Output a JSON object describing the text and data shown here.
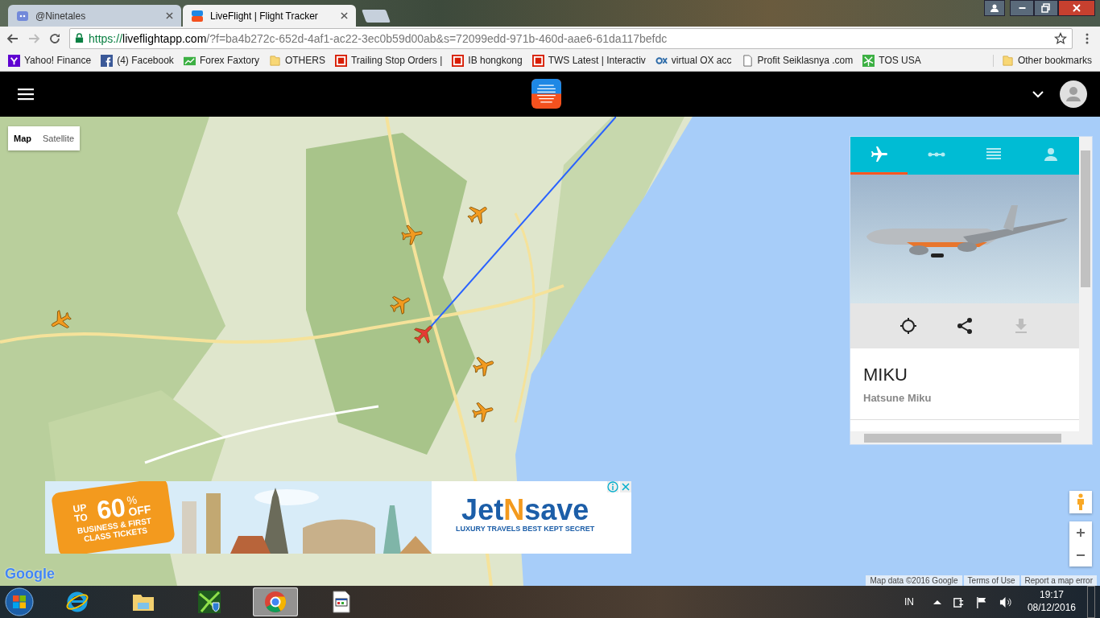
{
  "browser": {
    "tabs": [
      {
        "title": "@Ninetales",
        "selected": false,
        "kind": "discord"
      },
      {
        "title": "LiveFlight | Flight Tracker",
        "selected": true,
        "kind": "liveflight"
      }
    ],
    "url": {
      "scheme": "https://",
      "host": "liveflightapp.com",
      "path": "/?f=ba4b272c-652d-4af1-ac22-3ec0b59d00ab&s=72099edd-971b-460d-aae6-61da117befdc"
    },
    "bookmarks": [
      {
        "label": "Yahoo! Finance",
        "kind": "yahoo"
      },
      {
        "label": "(4) Facebook",
        "kind": "facebook"
      },
      {
        "label": "Forex Faxtory",
        "kind": "chart"
      },
      {
        "label": "OTHERS",
        "kind": "folder"
      },
      {
        "label": "Trailing Stop Orders |",
        "kind": "ib"
      },
      {
        "label": "IB hongkong",
        "kind": "ib"
      },
      {
        "label": "TWS Latest | Interactiv",
        "kind": "ib"
      },
      {
        "label": "virtual OX acc",
        "kind": "ox"
      },
      {
        "label": "Profit Seiklasnya .com",
        "kind": "page"
      },
      {
        "label": "TOS USA",
        "kind": "tos"
      }
    ],
    "other_bookmarks": "Other bookmarks"
  },
  "map": {
    "type_buttons": [
      {
        "label": "Map",
        "selected": true
      },
      {
        "label": "Satellite",
        "selected": false
      }
    ],
    "flights": [
      {
        "selected": false
      },
      {
        "selected": false
      },
      {
        "selected": false
      },
      {
        "selected": false
      },
      {
        "selected": true
      },
      {
        "selected": false
      },
      {
        "selected": false
      }
    ],
    "logo": "Google",
    "attribution": [
      "Map data ©2016 Google",
      "Terms of Use",
      "Report a map error"
    ]
  },
  "panel": {
    "tabs": [
      {
        "kind": "plane",
        "selected": true
      },
      {
        "kind": "route",
        "selected": false
      },
      {
        "kind": "list",
        "selected": false
      },
      {
        "kind": "person",
        "selected": false
      }
    ],
    "actions": [
      {
        "kind": "locate",
        "disabled": false
      },
      {
        "kind": "share",
        "disabled": false
      },
      {
        "kind": "download",
        "disabled": true
      }
    ],
    "callsign": "MIKU",
    "pilot": "Hatsune Miku"
  },
  "ad": {
    "up_to": "UP TO",
    "amount": "60",
    "percent": "%",
    "off": "OFF",
    "tickets": "BUSINESS & FIRST CLASS TICKETS",
    "brand_parts": [
      "Jet",
      "N",
      "save"
    ],
    "slogan": "LUXURY TRAVELS BEST KEPT SECRET"
  },
  "taskbar": {
    "apps": [
      {
        "kind": "ie",
        "selected": false
      },
      {
        "kind": "explorer",
        "selected": false
      },
      {
        "kind": "shield",
        "selected": false
      },
      {
        "kind": "chrome",
        "selected": true
      },
      {
        "kind": "window",
        "selected": false
      }
    ],
    "language": "IN",
    "time": "19:17",
    "date": "08/12/2016"
  }
}
